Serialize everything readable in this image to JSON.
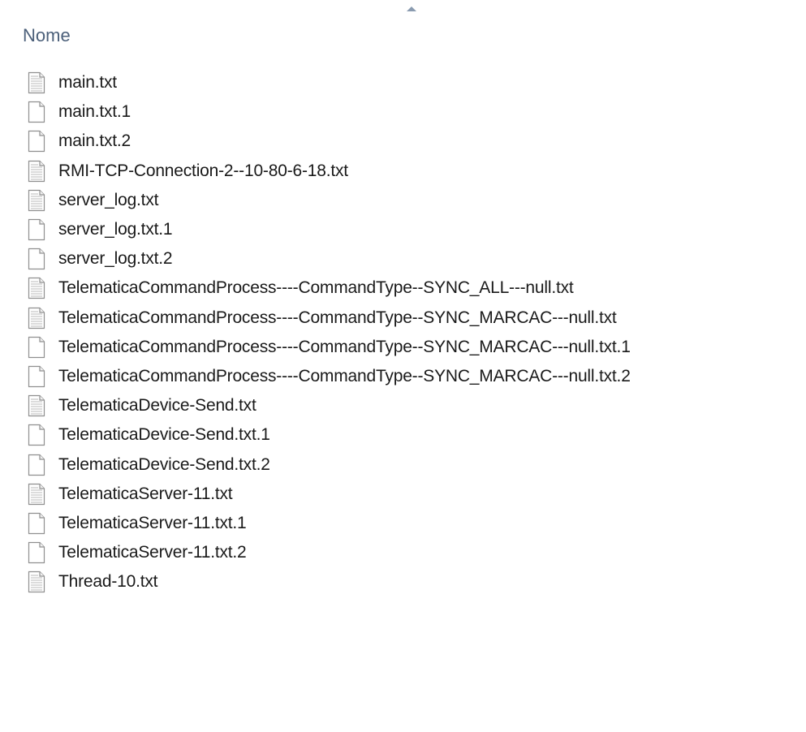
{
  "header": {
    "column_name": "Nome",
    "sort_direction": "ascending"
  },
  "files": [
    {
      "name": "main.txt",
      "icon": "text-document-icon"
    },
    {
      "name": "main.txt.1",
      "icon": "blank-document-icon"
    },
    {
      "name": "main.txt.2",
      "icon": "blank-document-icon"
    },
    {
      "name": "RMI-TCP-Connection-2--10-80-6-18.txt",
      "icon": "text-document-icon"
    },
    {
      "name": "server_log.txt",
      "icon": "text-document-icon"
    },
    {
      "name": "server_log.txt.1",
      "icon": "blank-document-icon"
    },
    {
      "name": "server_log.txt.2",
      "icon": "blank-document-icon"
    },
    {
      "name": "TelematicaCommandProcess----CommandType--SYNC_ALL---null.txt",
      "icon": "text-document-icon"
    },
    {
      "name": "TelematicaCommandProcess----CommandType--SYNC_MARCAC---null.txt",
      "icon": "text-document-icon"
    },
    {
      "name": "TelematicaCommandProcess----CommandType--SYNC_MARCAC---null.txt.1",
      "icon": "blank-document-icon"
    },
    {
      "name": "TelematicaCommandProcess----CommandType--SYNC_MARCAC---null.txt.2",
      "icon": "blank-document-icon"
    },
    {
      "name": "TelematicaDevice-Send.txt",
      "icon": "text-document-icon"
    },
    {
      "name": "TelematicaDevice-Send.txt.1",
      "icon": "blank-document-icon"
    },
    {
      "name": "TelematicaDevice-Send.txt.2",
      "icon": "blank-document-icon"
    },
    {
      "name": "TelematicaServer-11.txt",
      "icon": "text-document-icon"
    },
    {
      "name": "TelematicaServer-11.txt.1",
      "icon": "blank-document-icon"
    },
    {
      "name": "TelematicaServer-11.txt.2",
      "icon": "blank-document-icon"
    },
    {
      "name": "Thread-10.txt",
      "icon": "text-document-icon"
    }
  ],
  "colors": {
    "header_text": "#4c607a",
    "sort_arrow": "#8a9bb0",
    "icon_outline": "#8f8f8f",
    "icon_lines": "#b8b8b8"
  }
}
